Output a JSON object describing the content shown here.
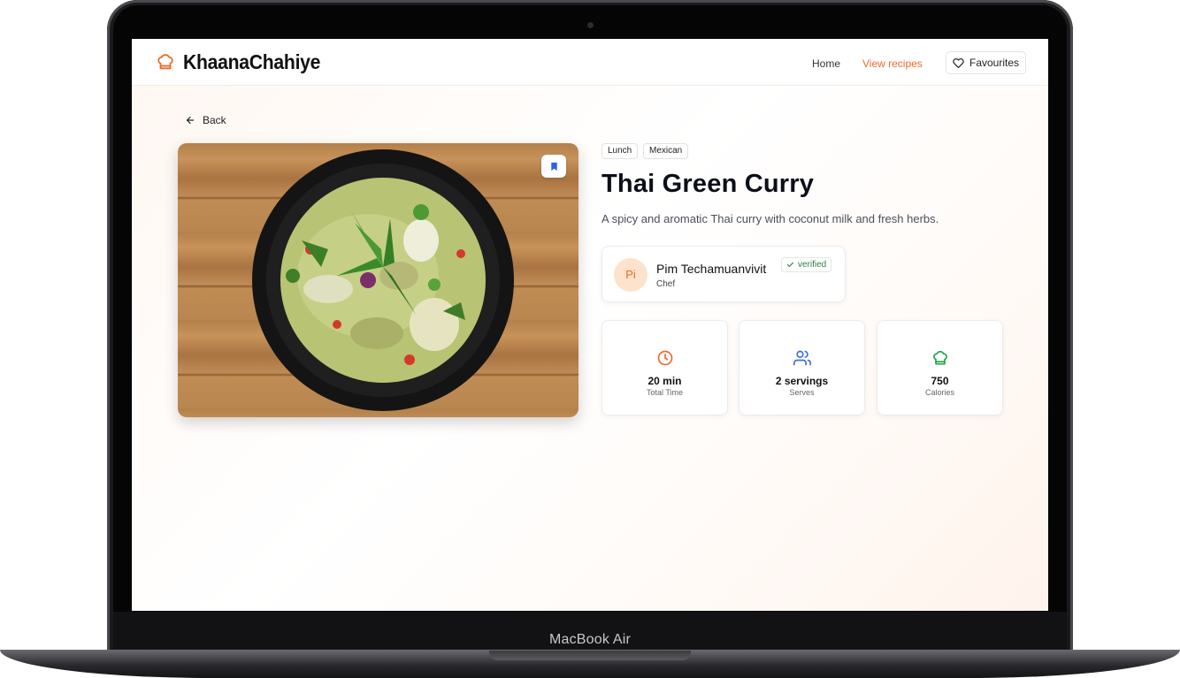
{
  "device": {
    "label": "MacBook Air"
  },
  "app": {
    "name": "KhaanaChahiye",
    "accent": "#f0692b"
  },
  "nav": {
    "home": "Home",
    "view_recipes": "View recipes",
    "favourites": "Favourites"
  },
  "back_label": "Back",
  "recipe": {
    "tags": [
      "Lunch",
      "Mexican"
    ],
    "title": "Thai Green Curry",
    "description": "A spicy and aromatic Thai curry with coconut milk and fresh herbs.",
    "chef": {
      "initials": "Pi",
      "name": "Pim Techamuanvivit",
      "role": "Chef",
      "badge": "verified"
    },
    "stats": [
      {
        "icon": "clock-icon",
        "value": "20 min",
        "label": "Total Time",
        "color": "#f0692b"
      },
      {
        "icon": "users-icon",
        "value": "2 servings",
        "label": "Serves",
        "color": "#3b6fe0"
      },
      {
        "icon": "chef-hat-icon",
        "value": "750",
        "label": "Calories",
        "color": "#22a04b"
      }
    ]
  }
}
